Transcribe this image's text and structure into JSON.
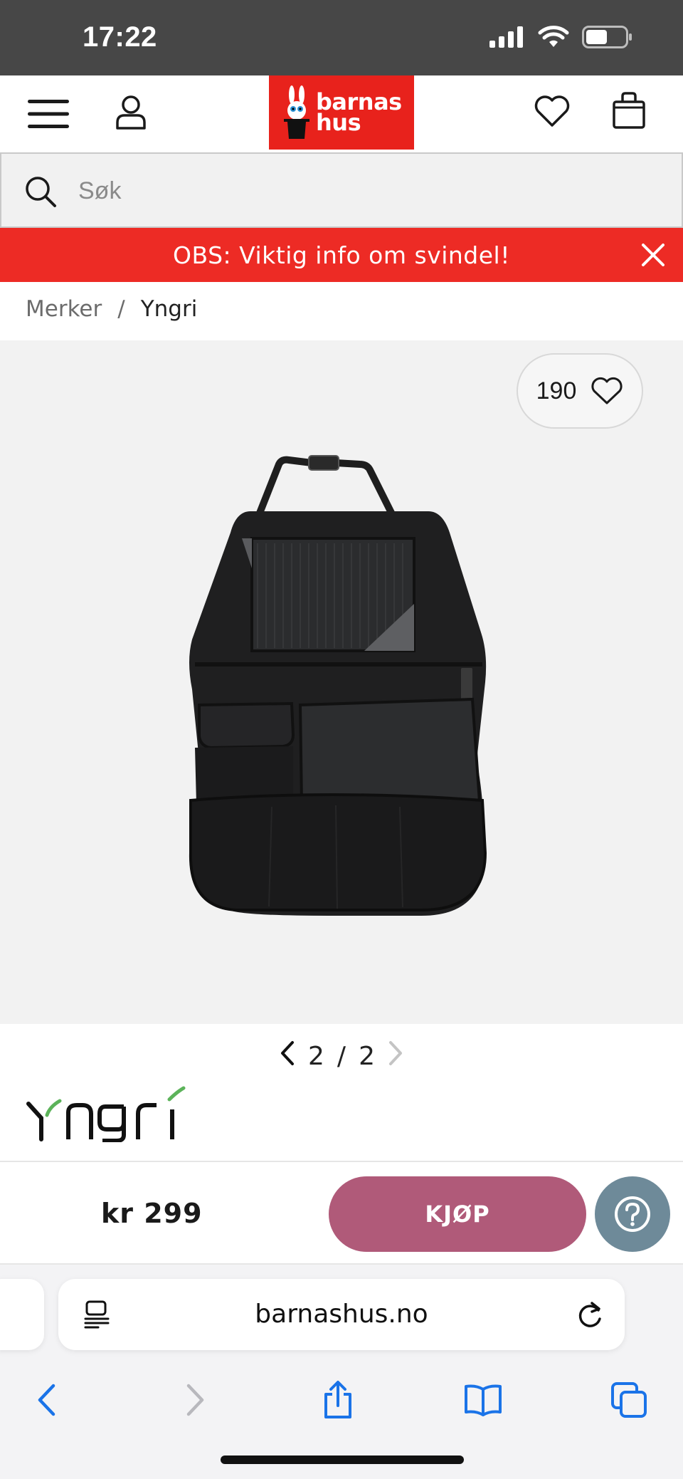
{
  "status_bar": {
    "time": "17:22",
    "battery_level": 0.55
  },
  "header": {
    "logo_text_line1": "barnas",
    "logo_text_line2": "hus",
    "accent_color": "#e8221c"
  },
  "search": {
    "placeholder": "Søk",
    "value": ""
  },
  "alert": {
    "text": "OBS: Viktig info om svindel!",
    "color": "#ed2b25"
  },
  "breadcrumb": {
    "items": [
      "Merker",
      "Yngri"
    ],
    "separator": "/"
  },
  "gallery": {
    "favorite_count": "190",
    "pager_current": "2",
    "pager_separator": "/",
    "pager_total": "2"
  },
  "brand": {
    "name": "Yngri"
  },
  "purchase": {
    "price": "kr 299",
    "buy_label": "KJØP",
    "buy_color": "#b05a79",
    "help_color": "#6e8a99"
  },
  "browser": {
    "url": "barnashus.no"
  }
}
